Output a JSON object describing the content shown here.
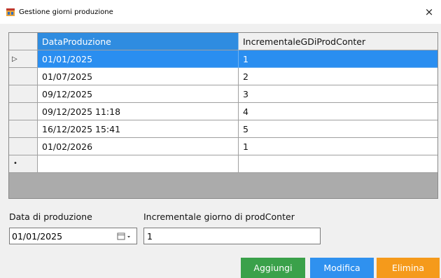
{
  "window": {
    "title": "Gestione giorni produzione",
    "close_symbol": "×",
    "icon": "form-window-icon"
  },
  "grid": {
    "columns": [
      "DataProduzione",
      "IncrementaleGDiProdConter"
    ],
    "rows": [
      {
        "data": "01/01/2025",
        "incrementale": "1",
        "selected": true
      },
      {
        "data": "01/07/2025",
        "incrementale": "2"
      },
      {
        "data": "09/12/2025",
        "incrementale": "3"
      },
      {
        "data": "09/12/2025 11:18",
        "incrementale": "4"
      },
      {
        "data": "16/12/2025 15:41",
        "incrementale": "5"
      },
      {
        "data": "01/02/2026",
        "incrementale": "1"
      }
    ],
    "current_row_marker": "▷",
    "new_row_marker": "•",
    "colors": {
      "selection": "#2a8ef0",
      "empty_area": "#ababab"
    }
  },
  "form": {
    "date_label": "Data di produzione",
    "date_value": "01/01/2025",
    "date_icon": "calendar-dropdown-icon",
    "increment_label": "Incrementale giorno di prodConter",
    "increment_value": "1"
  },
  "buttons": {
    "add": {
      "label": "Aggiungi",
      "color": "#3aa14a"
    },
    "modify": {
      "label": "Modifica",
      "color": "#2f91ef"
    },
    "delete": {
      "label": "Elimina",
      "color": "#f59a1b"
    }
  }
}
